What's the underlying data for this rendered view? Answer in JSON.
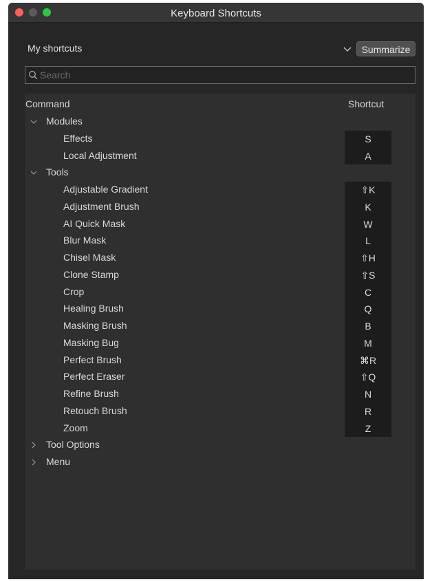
{
  "window": {
    "title": "Keyboard Shortcuts"
  },
  "preset": {
    "label": "My shortcuts",
    "summarize_label": "Summarize"
  },
  "search": {
    "placeholder": "Search"
  },
  "table": {
    "command_header": "Command",
    "shortcut_header": "Shortcut",
    "groups": [
      {
        "label": "Modules",
        "expanded": true,
        "items": [
          {
            "label": "Effects",
            "shortcut": "S"
          },
          {
            "label": "Local Adjustment",
            "shortcut": "A"
          }
        ]
      },
      {
        "label": "Tools",
        "expanded": true,
        "items": [
          {
            "label": "Adjustable Gradient",
            "shortcut": "⇧K"
          },
          {
            "label": "Adjustment Brush",
            "shortcut": "K"
          },
          {
            "label": "AI Quick Mask",
            "shortcut": "W"
          },
          {
            "label": "Blur Mask",
            "shortcut": "L"
          },
          {
            "label": "Chisel Mask",
            "shortcut": "⇧H"
          },
          {
            "label": "Clone Stamp",
            "shortcut": "⇧S"
          },
          {
            "label": "Crop",
            "shortcut": "C"
          },
          {
            "label": "Healing Brush",
            "shortcut": "Q"
          },
          {
            "label": "Masking Brush",
            "shortcut": "B"
          },
          {
            "label": "Masking Bug",
            "shortcut": "M"
          },
          {
            "label": "Perfect Brush",
            "shortcut": "⌘R"
          },
          {
            "label": "Perfect Eraser",
            "shortcut": "⇧Q"
          },
          {
            "label": "Refine Brush",
            "shortcut": "N"
          },
          {
            "label": "Retouch Brush",
            "shortcut": "R"
          },
          {
            "label": "Zoom",
            "shortcut": "Z"
          }
        ]
      },
      {
        "label": "Tool Options",
        "expanded": false,
        "items": []
      },
      {
        "label": "Menu",
        "expanded": false,
        "items": []
      }
    ]
  },
  "icons": {
    "close": "close-light-icon",
    "minimize": "minimize-light-icon",
    "zoom": "zoom-light-icon",
    "search": "search-icon",
    "expanded": "chevron-down-icon",
    "collapsed": "chevron-right-icon"
  },
  "colors": {
    "window_bg": "#262626",
    "titlebar_bg": "#363636",
    "panel_bg": "#2f2f2f",
    "shortcut_cell_bg": "#1c1c1c",
    "close": "#fe5f57",
    "zoom": "#28c840"
  }
}
